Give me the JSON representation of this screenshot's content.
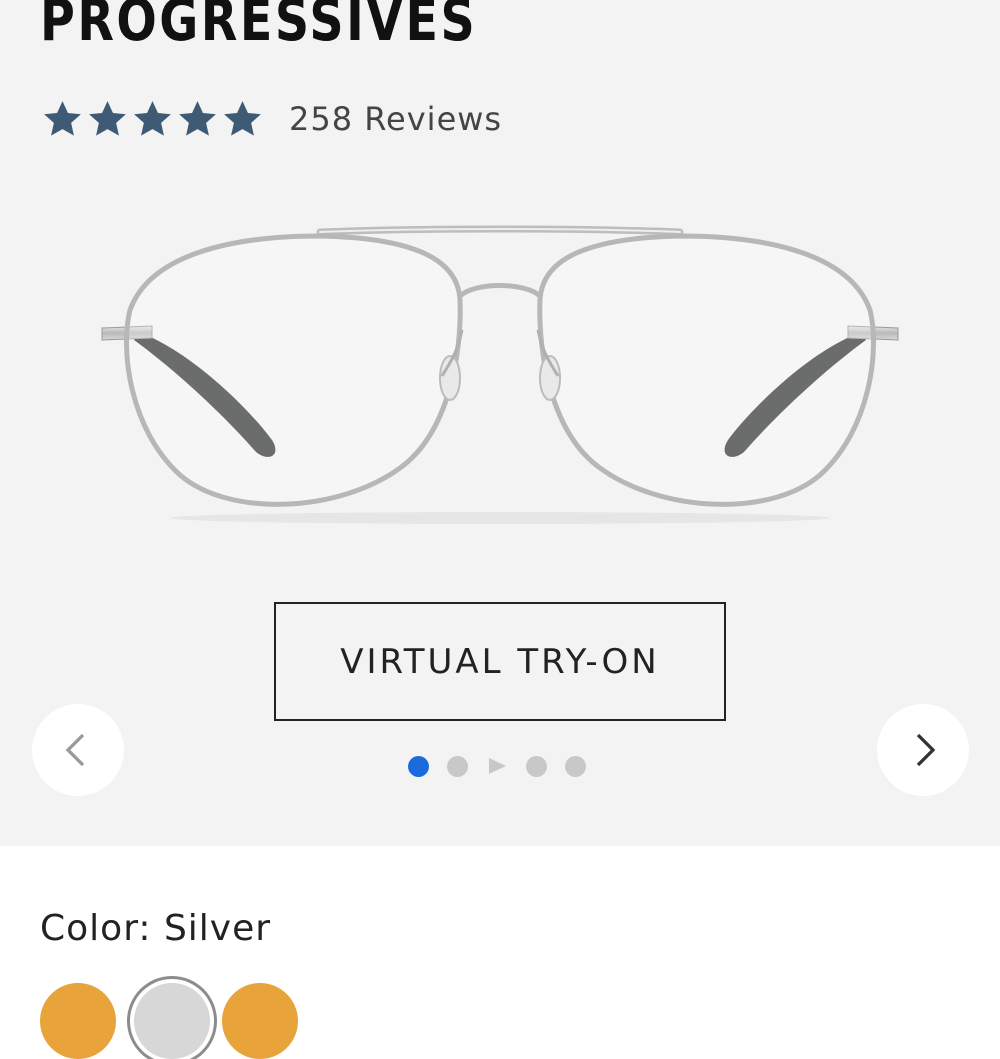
{
  "product": {
    "title": "PROGRESSIVES",
    "rating": 5,
    "rating_max": 5,
    "reviews_label": "258 Reviews"
  },
  "gallery": {
    "try_on_label": "VIRTUAL TRY-ON",
    "slide_count": 4,
    "active_slide": 1,
    "has_video": true
  },
  "color": {
    "label": "Color:",
    "selected": "Silver",
    "swatches": [
      {
        "name": "gold",
        "color": "#e8a33a"
      },
      {
        "name": "silver",
        "color": "#cfcfcf",
        "selected": true
      },
      {
        "name": "gold-2",
        "color": "#e8a33a"
      }
    ]
  },
  "colors": {
    "star": "#3f5a75",
    "dot_active": "#1a6cdc",
    "dot_inactive": "#c8c8c8",
    "hero_bg": "#f3f3f3"
  },
  "icons": {
    "prev": "chevron-left-icon",
    "next": "chevron-right-icon",
    "star": "star-icon",
    "play": "play-icon"
  }
}
